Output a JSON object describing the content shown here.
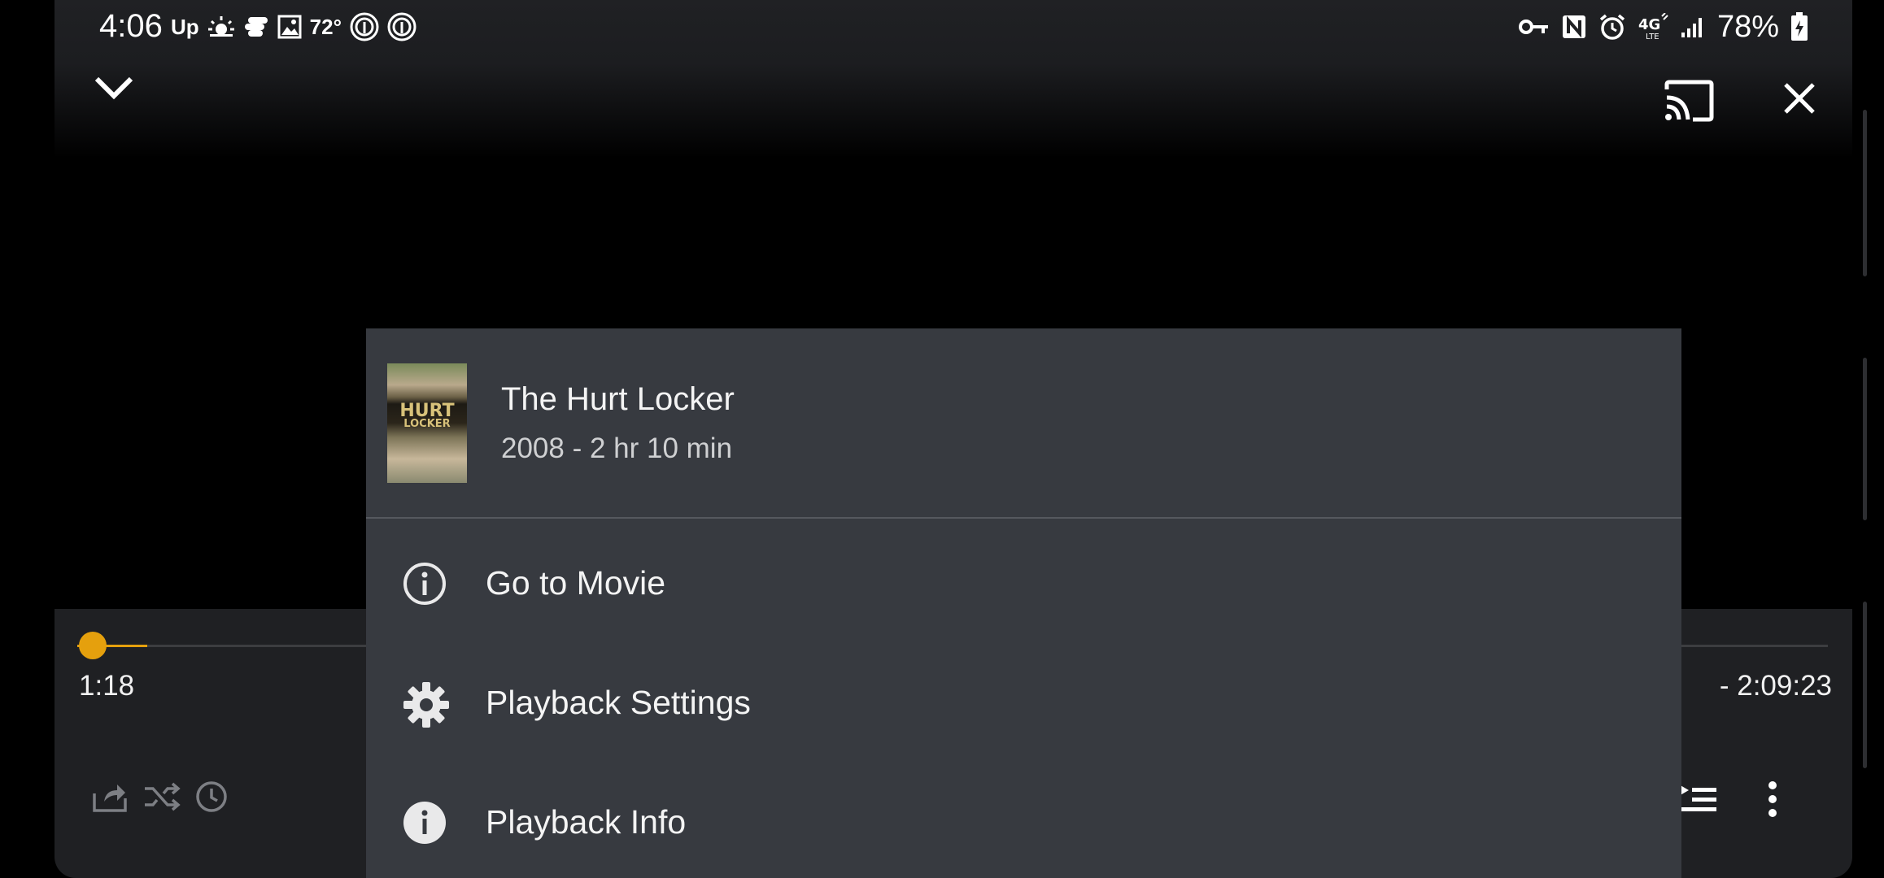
{
  "status_bar": {
    "time": "4:06",
    "left_icons": [
      "up-icon",
      "weather-icon",
      "app-icon",
      "image-icon"
    ],
    "temperature": "72°",
    "battery_percent": "78%",
    "right_icons": [
      "vpn-key-icon",
      "nfc-icon",
      "alarm-icon",
      "4g-lte-icon",
      "signal-icon",
      "battery-charging-icon"
    ]
  },
  "player": {
    "elapsed": "1:18",
    "remaining": "- 2:09:23",
    "progress_fraction": 0.01,
    "accent_color": "#e5a00d"
  },
  "menu": {
    "title": "The Hurt Locker",
    "meta": "2008 - 2 hr 10 min",
    "poster_text_line1": "HURT",
    "poster_text_line2": "LOCKER",
    "items": [
      {
        "label": "Go to Movie",
        "icon": "info-outline-icon"
      },
      {
        "label": "Playback Settings",
        "icon": "gear-icon"
      },
      {
        "label": "Playback Info",
        "icon": "info-filled-icon"
      }
    ]
  }
}
